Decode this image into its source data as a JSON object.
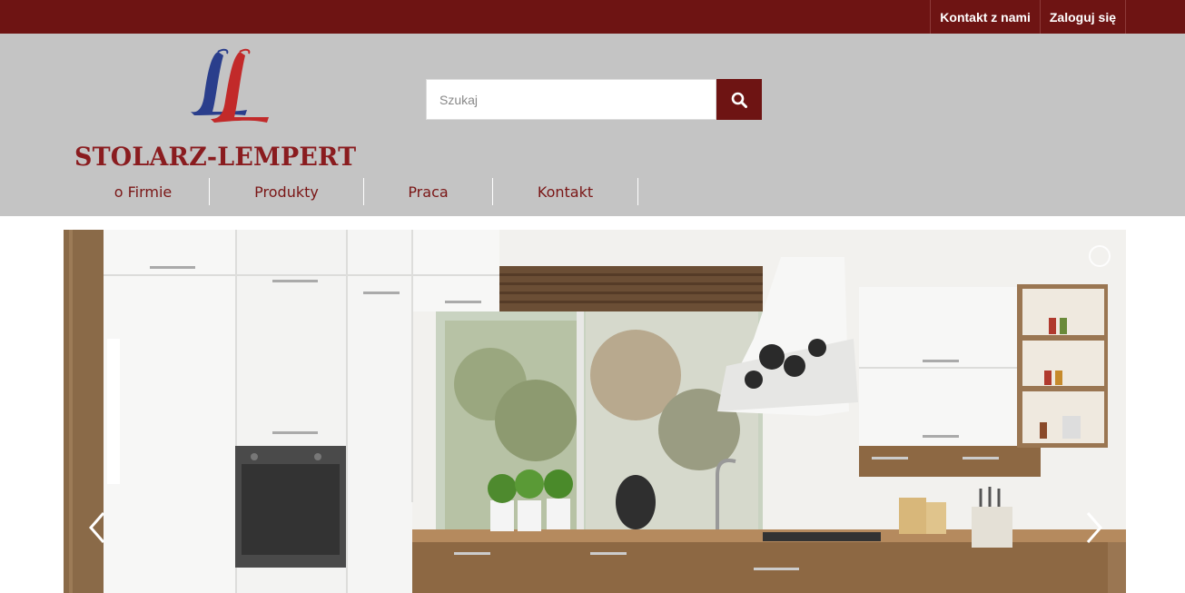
{
  "topbar": {
    "contact_label": "Kontakt z nami",
    "login_label": "Zaloguj się"
  },
  "logo": {
    "text": "STOLARZ-LEMPERT",
    "monogram": "LL"
  },
  "search": {
    "placeholder": "Szukaj",
    "value": "",
    "button_icon": "search-icon"
  },
  "nav": {
    "items": [
      {
        "label": "o Firmie"
      },
      {
        "label": "Produkty"
      },
      {
        "label": "Praca"
      },
      {
        "label": "Kontakt"
      }
    ]
  },
  "slider": {
    "prev_icon": "chevron-left-icon",
    "next_icon": "chevron-right-icon",
    "loading_icon": "loading-spinner-icon"
  },
  "colors": {
    "brand_dark_red": "#6e1413",
    "header_gray": "#c4c4c4",
    "nav_text": "#7a1616"
  }
}
